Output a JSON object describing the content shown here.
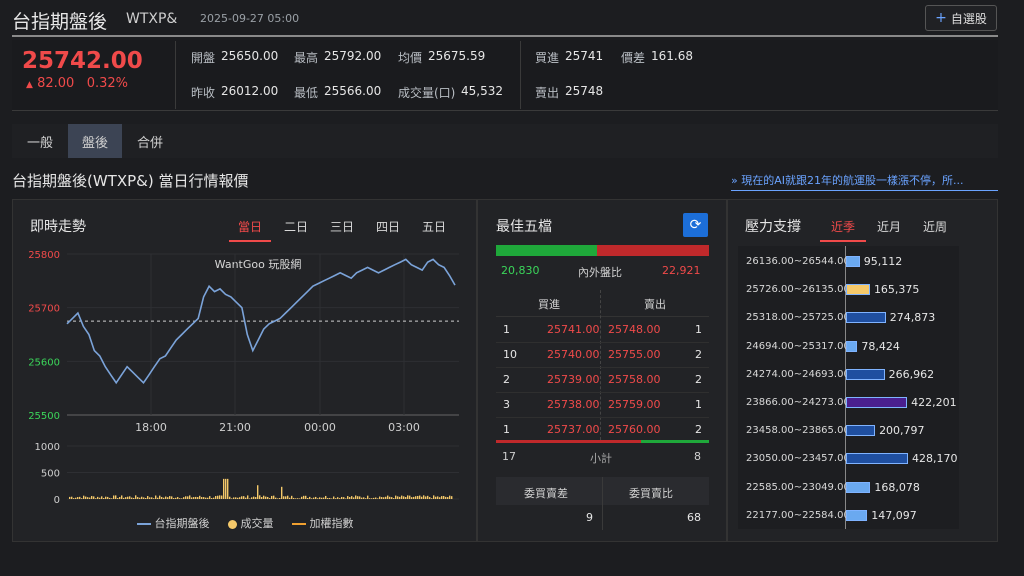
{
  "header": {
    "title": "台指期盤後",
    "code": "WTXP&",
    "datetime": "2025-09-27 05:00",
    "watch_label": "自選股"
  },
  "quote": {
    "price": "25742.00",
    "change": "82.00",
    "change_pct": "0.32%",
    "open_label": "開盤",
    "open": "25650.00",
    "high_label": "最高",
    "high": "25792.00",
    "avg_label": "均價",
    "avg": "25675.59",
    "prev_label": "昨收",
    "prev": "26012.00",
    "low_label": "最低",
    "low": "25566.00",
    "vol_label": "成交量(口)",
    "vol": "45,532",
    "bid_label": "買進",
    "bid": "25741",
    "spread_label": "價差",
    "spread": "161.68",
    "ask_label": "賣出",
    "ask": "25748"
  },
  "tabs": [
    "一般",
    "盤後",
    "合併"
  ],
  "section_title": "台指期盤後(WTXP&) 當日行情報價",
  "news_link": "» 現在的AI就跟21年的航運股一樣漲不停，所...",
  "intraday": {
    "title": "即時走勢",
    "range_tabs": [
      "當日",
      "二日",
      "三日",
      "四日",
      "五日"
    ],
    "watermark": "WantGoo 玩股網",
    "legend": [
      "台指期盤後",
      "成交量",
      "加權指數"
    ]
  },
  "chart_data": {
    "type": "line",
    "y_ticks": [
      "25800",
      "25700",
      "25600",
      "25500"
    ],
    "ylim": [
      25500,
      25800
    ],
    "x_ticks": [
      "18:00",
      "21:00",
      "00:00",
      "03:00"
    ],
    "reference_price": 25675,
    "volume_ticks": [
      "1000",
      "500",
      "0"
    ],
    "volume_ylim": [
      0,
      1000
    ],
    "series": [
      {
        "name": "台指期盤後",
        "values": [
          25670,
          25680,
          25690,
          25665,
          25650,
          25620,
          25610,
          25590,
          25575,
          25560,
          25575,
          25590,
          25580,
          25570,
          25560,
          25575,
          25590,
          25605,
          25610,
          25625,
          25640,
          25650,
          25660,
          25670,
          25680,
          25720,
          25740,
          25730,
          25735,
          25725,
          25720,
          25710,
          25700,
          25650,
          25620,
          25640,
          25660,
          25670,
          25675,
          25680,
          25690,
          25700,
          25710,
          25720,
          25730,
          25740,
          25745,
          25750,
          25755,
          25760,
          25765,
          25760,
          25755,
          25765,
          25770,
          25775,
          25770,
          25765,
          25770,
          25775,
          25780,
          25785,
          25790,
          25780,
          25775,
          25770,
          25785,
          25790,
          25780,
          25775,
          25760,
          25742
        ]
      }
    ]
  },
  "best_five": {
    "title": "最佳五檔",
    "inner_count": "20,830",
    "ratio_label": "內外盤比",
    "outer_count": "22,921",
    "inner_ratio": 0.476,
    "col_bid": "買進",
    "col_ask": "賣出",
    "rows": [
      {
        "bid_vol": "1",
        "bid": "25741.00",
        "ask": "25748.00",
        "ask_vol": "1"
      },
      {
        "bid_vol": "10",
        "bid": "25740.00",
        "ask": "25755.00",
        "ask_vol": "2"
      },
      {
        "bid_vol": "2",
        "bid": "25739.00",
        "ask": "25758.00",
        "ask_vol": "2"
      },
      {
        "bid_vol": "3",
        "bid": "25738.00",
        "ask": "25759.00",
        "ask_vol": "1"
      },
      {
        "bid_vol": "1",
        "bid": "25737.00",
        "ask": "25760.00",
        "ask_vol": "2"
      }
    ],
    "bid_total": "17",
    "subtotal_label": "小計",
    "ask_total": "8",
    "diff_label": "委買賣差",
    "ratio2_label": "委買賣比",
    "diff": "9",
    "ratio2": "68"
  },
  "pressure": {
    "title": "壓力支撐",
    "tabs": [
      "近季",
      "近月",
      "近周"
    ],
    "rows": [
      {
        "range": "26136.00~26544.00",
        "value": "95,112",
        "num": 95112,
        "color": "#6aa9f0"
      },
      {
        "range": "25726.00~26135.00",
        "value": "165,375",
        "num": 165375,
        "color": "#f5c96a"
      },
      {
        "range": "25318.00~25725.00",
        "value": "274,873",
        "num": 274873,
        "color": "#1f4fa0"
      },
      {
        "range": "24694.00~25317.00",
        "value": "78,424",
        "num": 78424,
        "color": "#6aa9f0"
      },
      {
        "range": "24274.00~24693.00",
        "value": "266,962",
        "num": 266962,
        "color": "#1f4fa0"
      },
      {
        "range": "23866.00~24273.00",
        "value": "422,201",
        "num": 422201,
        "color": "#4a1f8f"
      },
      {
        "range": "23458.00~23865.00",
        "value": "200,797",
        "num": 200797,
        "color": "#1f4fa0"
      },
      {
        "range": "23050.00~23457.00",
        "value": "428,170",
        "num": 428170,
        "color": "#1f4fa0"
      },
      {
        "range": "22585.00~23049.00",
        "value": "168,078",
        "num": 168078,
        "color": "#6aa9f0"
      },
      {
        "range": "22177.00~22584.00",
        "value": "147,097",
        "num": 147097,
        "color": "#6aa9f0"
      }
    ]
  }
}
